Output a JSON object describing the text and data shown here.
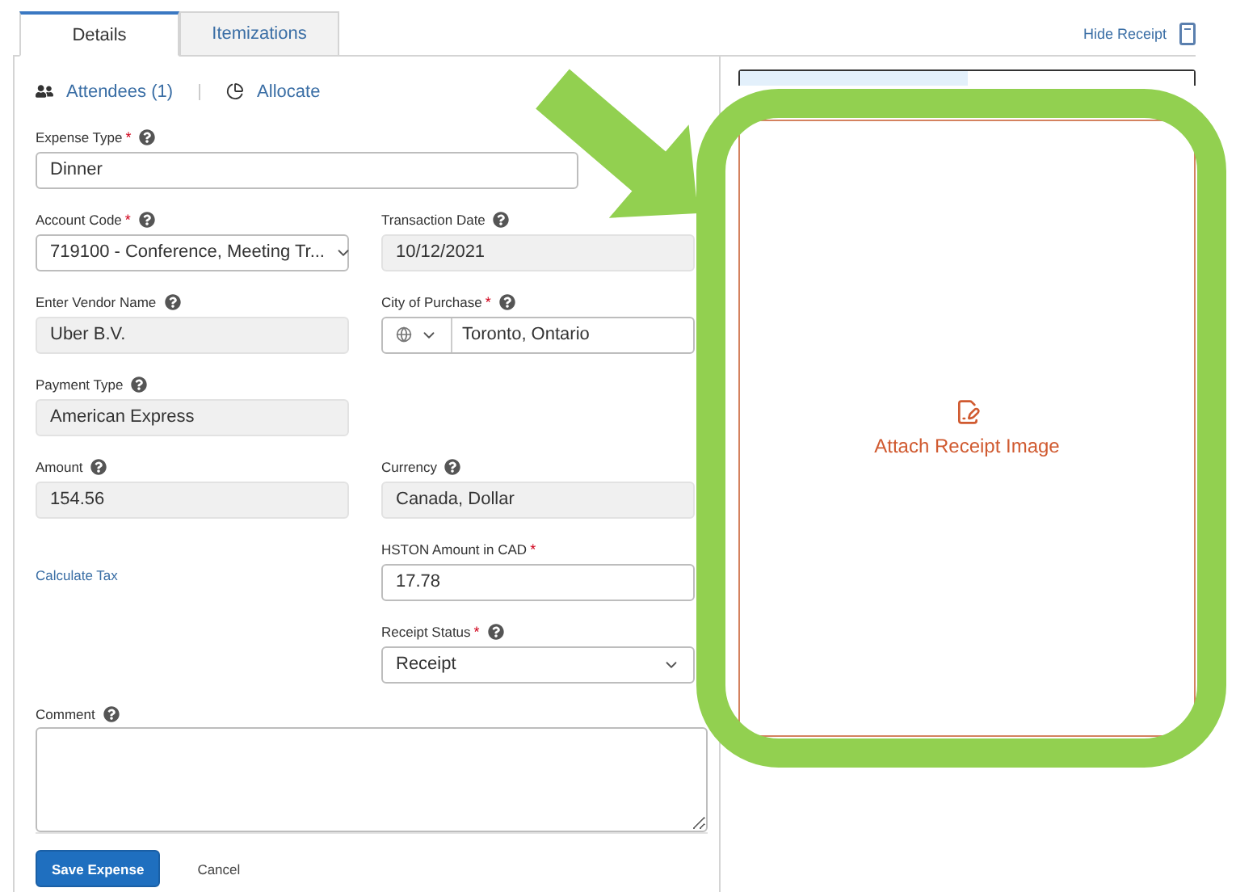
{
  "tabs": [
    {
      "label": "Details",
      "selected": true
    },
    {
      "label": "Itemizations",
      "selected": false
    }
  ],
  "hide_receipt": "Hide Receipt",
  "actions": [
    {
      "kind": "attendees",
      "label": "Attendees (1)"
    },
    {
      "kind": "allocate",
      "label": "Allocate"
    }
  ],
  "rows": [
    {
      "full": {
        "label": "Expense Type",
        "marker": "*",
        "help": true,
        "value": "Dinner"
      }
    },
    {
      "left": {
        "kind": "select",
        "label": "Account Code",
        "marker": "*",
        "help": true,
        "value": "719100 - Conference, Meeting Tr..."
      },
      "right": {
        "kind": "readonly",
        "label": "Transaction Date",
        "help": true,
        "value": "10/12/2021"
      }
    },
    {
      "left": {
        "kind": "readonly",
        "label": "Enter Vendor Name",
        "help": true,
        "value": "Uber B.V."
      },
      "right": {
        "kind": "city",
        "label": "City of Purchase",
        "marker": "*",
        "help": true,
        "value": "Toronto, Ontario"
      }
    },
    {
      "left": {
        "kind": "readonly",
        "label": "Payment Type",
        "help": true,
        "value": "American Express"
      }
    },
    {
      "left": {
        "kind": "readonly",
        "label": "Amount",
        "help": true,
        "value": "154.56"
      },
      "right": {
        "kind": "readonly",
        "label": "Currency",
        "help": true,
        "value": "Canada, Dollar"
      }
    },
    {
      "left": {
        "kind": "link",
        "label": "Calculate Tax"
      },
      "right": {
        "kind": "text",
        "label": "HSTON Amount in CAD",
        "marker": "*",
        "help": false,
        "value": "17.78"
      }
    },
    {
      "right": {
        "kind": "select",
        "label": "Receipt Status",
        "marker": "*",
        "help": true,
        "value": "Receipt"
      }
    }
  ],
  "comment": {
    "label": "Comment",
    "help": true
  },
  "buttons": [
    {
      "kind": "primary",
      "label": "Save Expense"
    },
    {
      "kind": "link",
      "label": "Cancel"
    }
  ],
  "receipt": {
    "tabs": [
      {
        "selected": true
      },
      {
        "selected": false
      }
    ],
    "attach": "Attach Receipt Image"
  }
}
